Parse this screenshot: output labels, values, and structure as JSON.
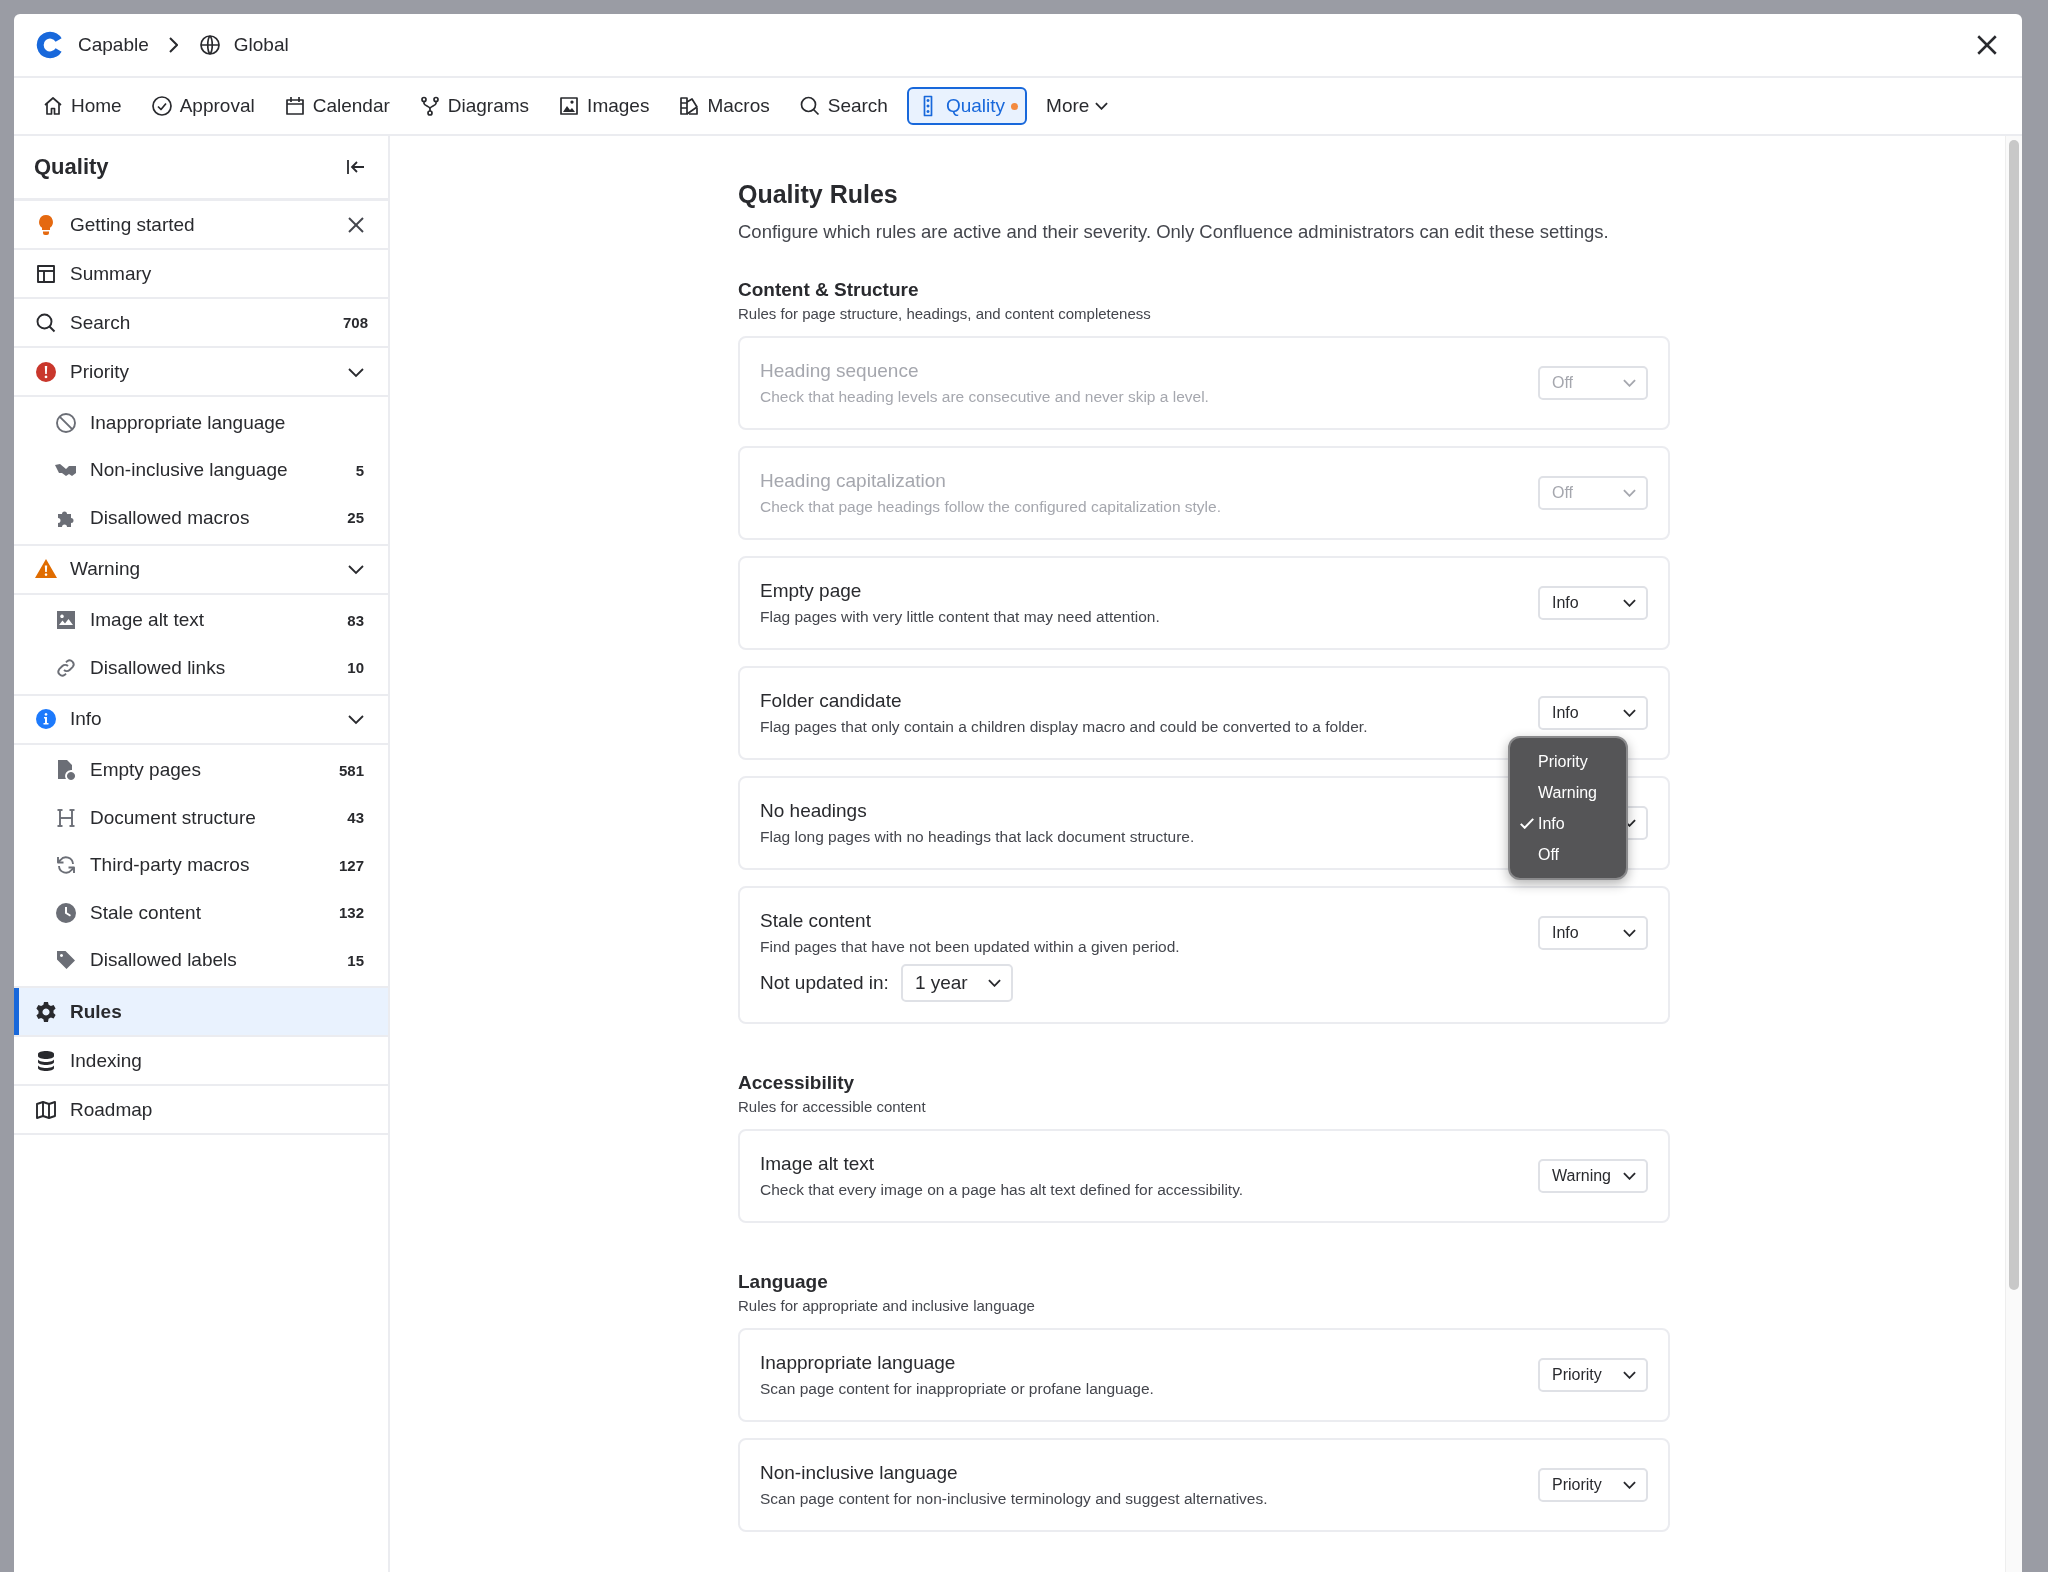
{
  "app": {
    "name": "Capable",
    "space": "Global"
  },
  "nav": [
    {
      "kind": "tab",
      "label": "Home",
      "selected": false,
      "dot": false
    },
    {
      "kind": "tab",
      "label": "Approval",
      "selected": false,
      "dot": false
    },
    {
      "kind": "tab",
      "label": "Calendar",
      "selected": false,
      "dot": false
    },
    {
      "kind": "tab",
      "label": "Diagrams",
      "selected": false,
      "dot": false
    },
    {
      "kind": "tab",
      "label": "Images",
      "selected": false,
      "dot": false
    },
    {
      "kind": "tab",
      "label": "Macros",
      "selected": false,
      "dot": false
    },
    {
      "kind": "tab",
      "label": "Search",
      "selected": false,
      "dot": false
    },
    {
      "kind": "tab",
      "label": "Quality",
      "selected": true,
      "dot": true
    },
    {
      "kind": "menu",
      "label": "More",
      "selected": false,
      "dot": false
    }
  ],
  "sidebar": {
    "title": "Quality",
    "items": [
      {
        "kind": "notice",
        "label": "Getting started",
        "selected": false
      },
      {
        "kind": "link",
        "label": "Summary",
        "selected": false
      },
      {
        "kind": "link",
        "label": "Search",
        "count": "708",
        "selected": false
      },
      {
        "kind": "group",
        "label": "Priority",
        "selected": false,
        "expanded": true,
        "children": [
          {
            "label": "Inappropriate language",
            "selected": false
          },
          {
            "label": "Non-inclusive language",
            "count": "5",
            "selected": false
          },
          {
            "label": "Disallowed macros",
            "count": "25",
            "selected": false
          }
        ]
      },
      {
        "kind": "group",
        "label": "Warning",
        "selected": false,
        "expanded": true,
        "children": [
          {
            "label": "Image alt text",
            "count": "83",
            "selected": false
          },
          {
            "label": "Disallowed links",
            "count": "10",
            "selected": false
          }
        ]
      },
      {
        "kind": "group",
        "label": "Info",
        "selected": false,
        "expanded": true,
        "children": [
          {
            "label": "Empty pages",
            "count": "581",
            "selected": false
          },
          {
            "label": "Document structure",
            "count": "43",
            "selected": false
          },
          {
            "label": "Third-party macros",
            "count": "127",
            "selected": false
          },
          {
            "label": "Stale content",
            "count": "132",
            "selected": false
          },
          {
            "label": "Disallowed labels",
            "count": "15",
            "selected": false
          }
        ]
      },
      {
        "kind": "link",
        "label": "Rules",
        "selected": true
      },
      {
        "kind": "link",
        "label": "Indexing",
        "selected": false
      },
      {
        "kind": "link",
        "label": "Roadmap",
        "selected": false
      }
    ]
  },
  "content": {
    "title": "Quality Rules",
    "description": "Configure which rules are active and their severity. Only Confluence administrators can edit these settings.",
    "sections": [
      {
        "title": "Content & Structure",
        "subtitle": "Rules for page structure, headings, and content completeness",
        "rules": [
          {
            "name": "Heading sequence",
            "description": "Check that heading levels are consecutive and never skip a level.",
            "value": "Off",
            "disabled": true
          },
          {
            "name": "Heading capitalization",
            "description": "Check that page headings follow the configured capitalization style.",
            "value": "Off",
            "disabled": true
          },
          {
            "name": "Empty page",
            "description": "Flag pages with very little content that may need attention.",
            "value": "Info",
            "disabled": false
          },
          {
            "name": "Folder candidate",
            "description": "Flag pages that only contain a children display macro and could be converted to a folder.",
            "value": "Info",
            "disabled": false,
            "menu": [
              {
                "label": "Priority",
                "selected": false
              },
              {
                "label": "Warning",
                "selected": false
              },
              {
                "label": "Info",
                "selected": true
              },
              {
                "label": "Off",
                "selected": false
              }
            ]
          },
          {
            "name": "No headings",
            "description": "Flag long pages with no headings that lack document structure.",
            "disabled": false
          },
          {
            "name": "Stale content",
            "description": "Find pages that have not been updated within a given period.",
            "value": "Info",
            "disabled": false,
            "extra": {
              "label": "Not updated in:",
              "value": "1 year"
            }
          }
        ]
      },
      {
        "title": "Accessibility",
        "subtitle": "Rules for accessible content",
        "rules": [
          {
            "name": "Image alt text",
            "description": "Check that every image on a page has alt text defined for accessibility.",
            "value": "Warning",
            "disabled": false
          }
        ]
      },
      {
        "title": "Language",
        "subtitle": "Rules for appropriate and inclusive language",
        "rules": [
          {
            "name": "Inappropriate language",
            "description": "Scan page content for inappropriate or profane language.",
            "value": "Priority",
            "disabled": false
          },
          {
            "name": "Non-inclusive language",
            "description": "Scan page content for non-inclusive terminology and suggest alternatives.",
            "value": "Priority",
            "disabled": false
          }
        ]
      }
    ]
  }
}
